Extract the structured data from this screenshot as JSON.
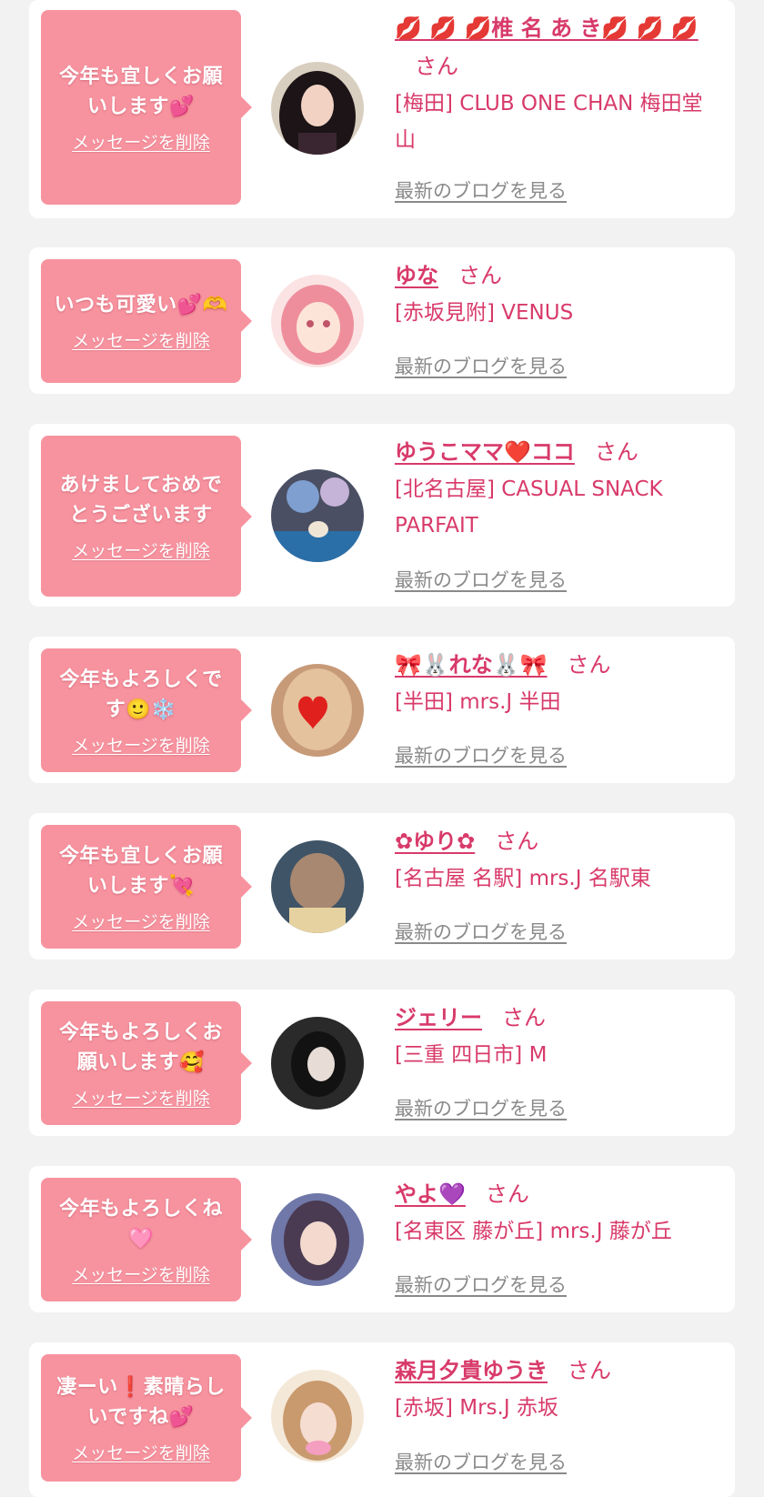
{
  "common": {
    "delete_label": "メッセージを削除",
    "blog_label": "最新のブログを見る",
    "honorific": "さん"
  },
  "colors": {
    "page_bg": "#f2f2f2",
    "card_bg": "#ffffff",
    "bubble_bg": "#f7939f",
    "name_color": "#d83a6a",
    "blog_link_color": "#8a8a8a"
  },
  "entries": [
    {
      "message": "今年も宜しくお願いします💕",
      "name": "💋 💋 💋椎 名 あ き💋 💋 💋",
      "store": "[梅田] CLUB ONE CHAN 梅田堂山",
      "avatar_icon": "avatar-photo-icon"
    },
    {
      "message": "いつも可愛い💕🫶",
      "name": "ゆな",
      "store": "[赤坂見附] VENUS",
      "avatar_icon": "avatar-illustration-icon"
    },
    {
      "message": "あけましておめでとうございます",
      "name": "ゆうこママ❤️ココ",
      "store": "[北名古屋] CASUAL SNACK PARFAIT",
      "avatar_icon": "avatar-photo-icon"
    },
    {
      "message": "今年もよろしくです🙂❄️",
      "name": "🎀🐰れな🐰🎀",
      "store": "[半田] mrs.J 半田",
      "avatar_icon": "avatar-photo-icon"
    },
    {
      "message": "今年も宜しくお願いします💘",
      "name": "✿ゆり✿",
      "store": "[名古屋 名駅] mrs.J 名駅東",
      "avatar_icon": "avatar-photo-icon"
    },
    {
      "message": "今年もよろしくお願いします🥰",
      "name": "ジェリー",
      "store": "[三重 四日市] M",
      "avatar_icon": "avatar-photo-icon"
    },
    {
      "message": "今年もよろしくね🩷",
      "name": "やよ💜",
      "store": "[名東区 藤が丘] mrs.J 藤が丘",
      "avatar_icon": "avatar-photo-icon"
    },
    {
      "message": "凄ーい❗素晴らしいですね💕",
      "name": "森月夕貴ゆうき",
      "store": "[赤坂] Mrs.J 赤坂",
      "avatar_icon": "avatar-photo-icon"
    }
  ]
}
